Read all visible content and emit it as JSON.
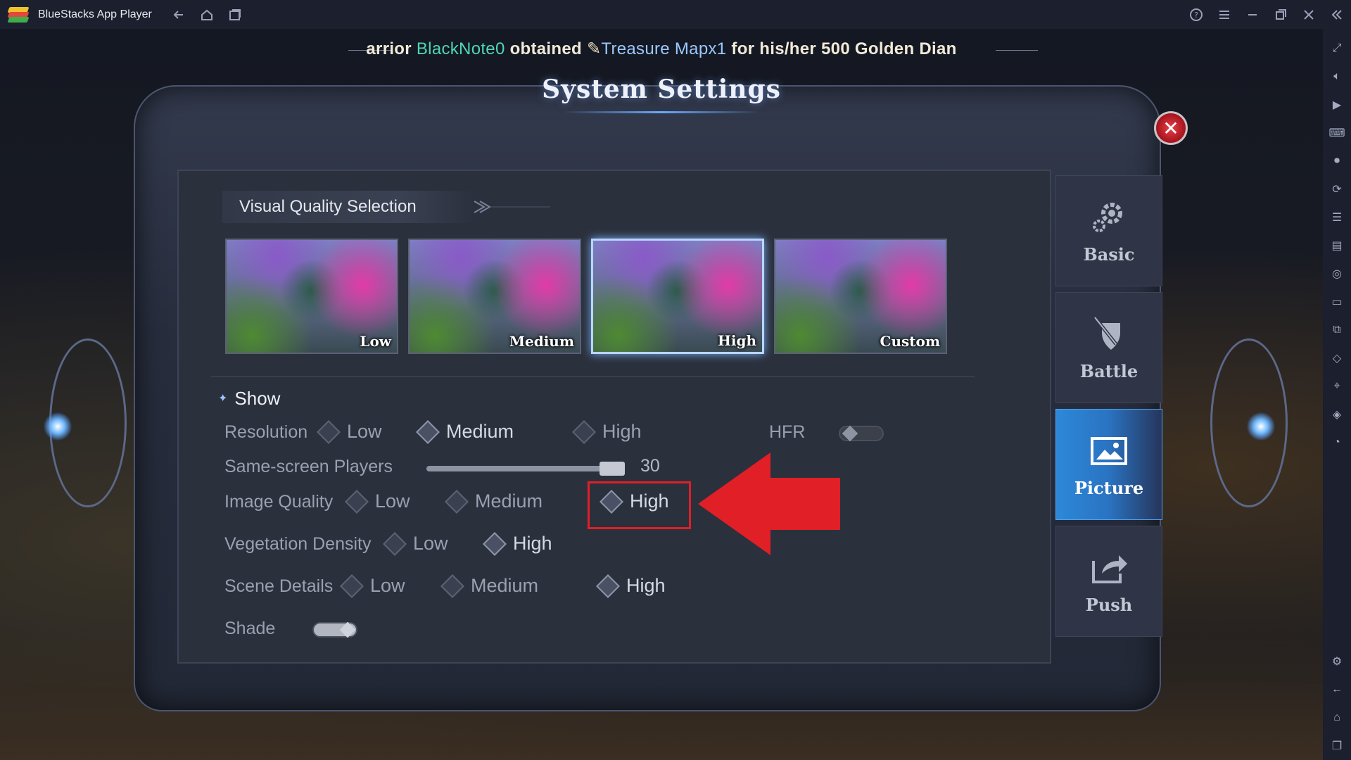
{
  "app": {
    "title": "BlueStacks App Player"
  },
  "titlebar": {
    "left_icons": [
      "back-icon",
      "home-icon",
      "multi-instance-icon"
    ],
    "right_icons": [
      "help-icon",
      "menu-icon",
      "minimize-icon",
      "restore-icon",
      "close-icon",
      "collapse-sidebar-icon"
    ]
  },
  "sidebar": {
    "top_icons": [
      "fullscreen-icon",
      "volume-icon",
      "media-icon",
      "keyboard-icon",
      "record-icon",
      "rotate-icon",
      "gamepad-icon",
      "apk-icon",
      "screenshot-icon",
      "folder-icon",
      "multi-window-icon",
      "eraser-icon",
      "location-icon",
      "layers-icon",
      "eco-mode-icon"
    ],
    "bottom_icons": [
      "settings-icon",
      "back-icon",
      "home-icon",
      "recent-apps-icon"
    ]
  },
  "ticker": {
    "prefix": "arrior ",
    "player": "BlackNote0",
    "mid": " obtained ",
    "item": "Treasure Mapx1",
    "suffix": " for his/her 500 Golden Dian"
  },
  "settings": {
    "title": "System Settings",
    "visual_quality": {
      "header": "Visual Quality Selection",
      "presets": [
        {
          "label": "Low",
          "selected": false
        },
        {
          "label": "Medium",
          "selected": false
        },
        {
          "label": "High",
          "selected": true
        },
        {
          "label": "Custom",
          "selected": false
        }
      ]
    },
    "show": {
      "label": "Show",
      "resolution": {
        "label": "Resolution",
        "options": [
          "Low",
          "Medium",
          "High"
        ],
        "selected": "Medium"
      },
      "hfr": {
        "label": "HFR",
        "on": false
      },
      "same_screen_players": {
        "label": "Same-screen Players",
        "value": "30",
        "fraction": 1.0
      },
      "image_quality": {
        "label": "Image Quality",
        "options": [
          "Low",
          "Medium",
          "High"
        ],
        "selected": "High"
      },
      "vegetation_density": {
        "label": "Vegetation Density",
        "options": [
          "Low",
          "High"
        ],
        "selected": "High"
      },
      "scene_details": {
        "label": "Scene Details",
        "options": [
          "Low",
          "Medium",
          "High"
        ],
        "selected": "High"
      },
      "shade": {
        "label": "Shade",
        "on": true
      }
    },
    "tabs": [
      {
        "label": "Basic",
        "icon": "gear-icon",
        "active": false
      },
      {
        "label": "Battle",
        "icon": "sword-shield-icon",
        "active": false
      },
      {
        "label": "Picture",
        "icon": "picture-icon",
        "active": true
      },
      {
        "label": "Push",
        "icon": "share-icon",
        "active": false
      }
    ]
  },
  "colors": {
    "accent": "#2d88d8",
    "highlight_annotation": "#e11f26",
    "ticker_player": "#4fd6b4",
    "ticker_item": "#9cc8ff"
  }
}
